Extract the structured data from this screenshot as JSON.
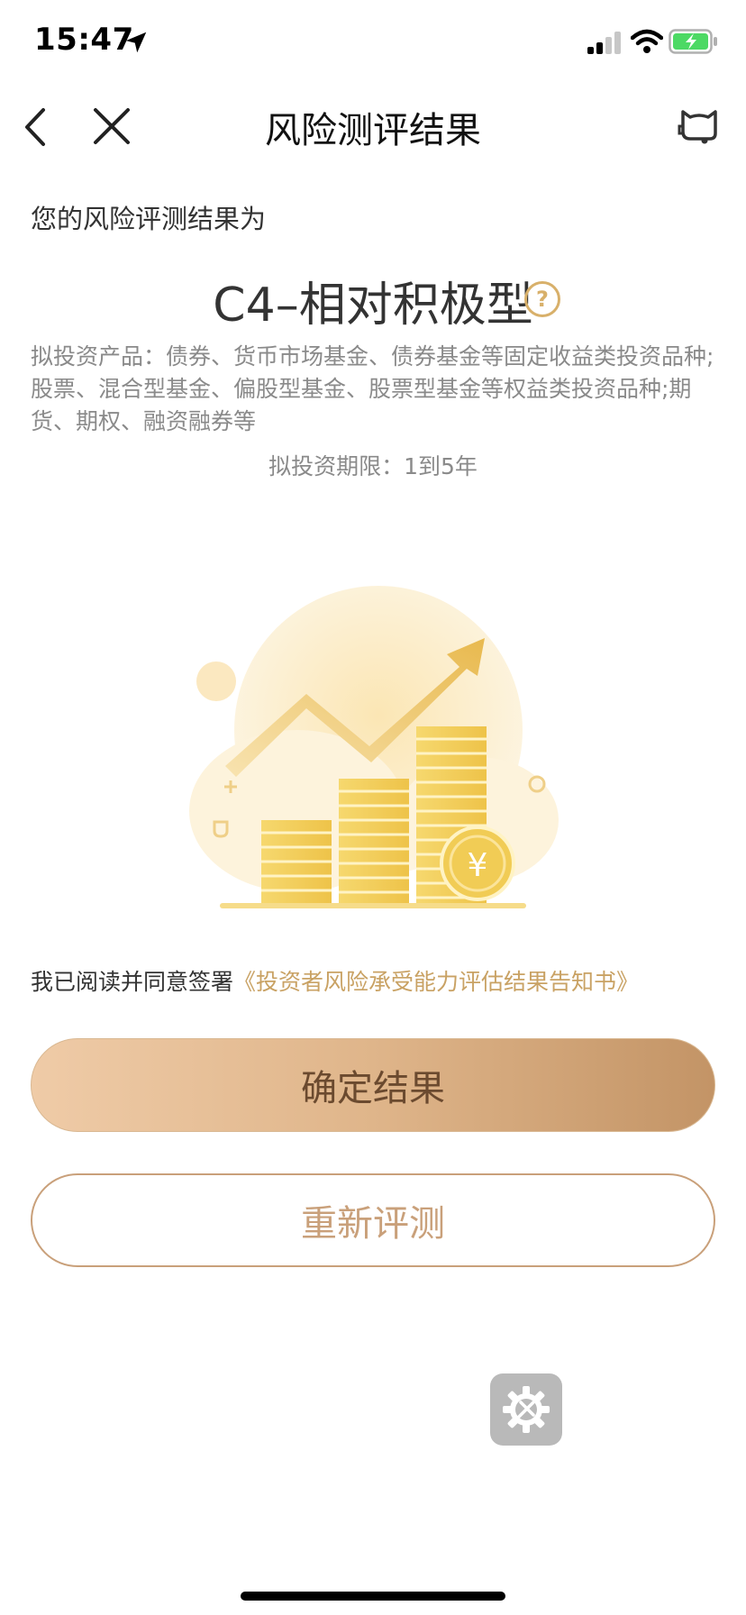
{
  "status_bar": {
    "time": "15:47",
    "icons": [
      "location-arrow-icon",
      "signal-icon",
      "wifi-icon",
      "battery-charging-icon"
    ]
  },
  "nav": {
    "title": "风险测评结果",
    "icons": [
      "back-chevron-icon",
      "close-icon",
      "customer-service-icon"
    ]
  },
  "result": {
    "intro": "您的风险评测结果为",
    "level": "C4–相对积极型",
    "help_glyph": "?",
    "products": "拟投资产品：债券、货币市场基金、债券基金等固定收益类投资品种;股票、混合型基金、偏股型基金、股票型基金等权益类投资品种;期货、期权、融资融券等",
    "period": "拟投资期限：1到5年"
  },
  "illustration": {
    "icon": "rising-coins-illustration",
    "currency_symbol": "¥"
  },
  "agreement": {
    "prefix": "我已阅读并同意签署",
    "link": "《投资者风险承受能力评估结果告知书》"
  },
  "buttons": {
    "confirm": "确定结果",
    "retest": "重新评测"
  },
  "colors": {
    "accent_gold": "#c9a264",
    "button_gradient_start": "#efcba7",
    "button_gradient_end": "#c39466",
    "secondary_text": "#8a8a8a"
  }
}
